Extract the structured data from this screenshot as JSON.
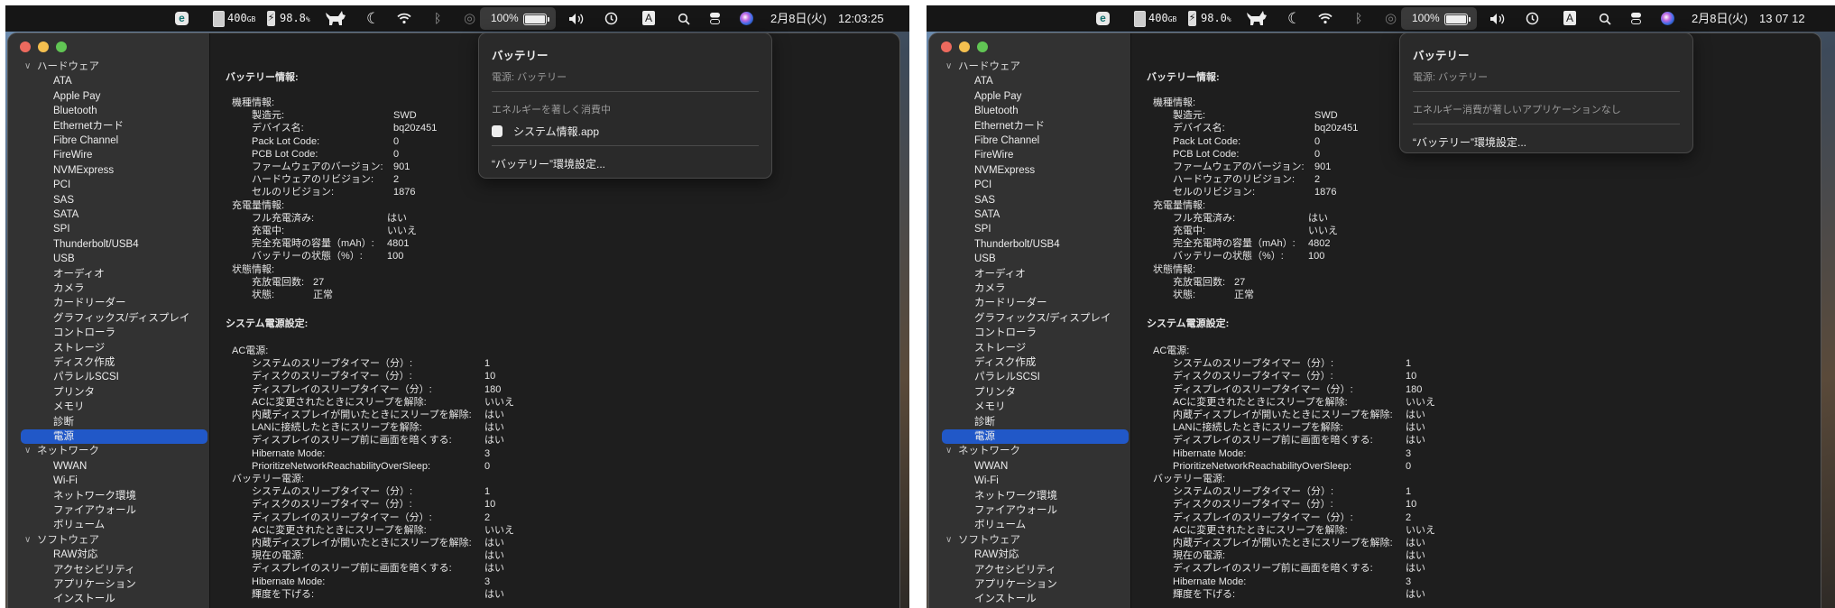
{
  "sidebar": {
    "groups": [
      {
        "label": "ハードウェア",
        "items": [
          "ATA",
          "Apple Pay",
          "Bluetooth",
          "Ethernetカード",
          "Fibre Channel",
          "FireWire",
          "NVMExpress",
          "PCI",
          "SAS",
          "SATA",
          "SPI",
          "Thunderbolt/USB4",
          "USB",
          "オーディオ",
          "カメラ",
          "カードリーダー",
          "グラフィックス/ディスプレイ",
          "コントローラ",
          "ストレージ",
          "ディスク作成",
          "パラレルSCSI",
          "プリンタ",
          "メモリ",
          "診断",
          "電源"
        ]
      },
      {
        "label": "ネットワーク",
        "items": [
          "WWAN",
          "Wi-Fi",
          "ネットワーク環境",
          "ファイアウォール",
          "ボリューム"
        ]
      },
      {
        "label": "ソフトウェア",
        "items": [
          "RAW対応",
          "アクセシビリティ",
          "アプリケーション",
          "インストール"
        ]
      }
    ],
    "selected": "電源",
    "selected_color": "#2158c8"
  },
  "panels": [
    {
      "menubar": {
        "eset": "e",
        "disk_free": "400",
        "disk_unit": "GB",
        "cpu": "98.8",
        "cpu_unit": "%",
        "battery_percent": "100%",
        "ime": "A",
        "date": "2月8日(火)",
        "time": "12:03:25"
      },
      "battery_menu": {
        "title": "バッテリー",
        "power_source": "電源: バッテリー",
        "energy_header": "エネルギーを著しく消費中",
        "apps": [
          "システム情報.app"
        ],
        "preferences": "“バッテリー”環境設定..."
      },
      "content": {
        "battery_title": "バッテリー情報:",
        "model_header": "機種情報:",
        "model": [
          [
            "製造元:",
            "SWD"
          ],
          [
            "デバイス名:",
            "bq20z451"
          ],
          [
            "Pack Lot Code:",
            "0"
          ],
          [
            "PCB Lot Code:",
            "0"
          ],
          [
            "ファームウェアのバージョン:",
            "901"
          ],
          [
            "ハードウェアのリビジョン:",
            "2"
          ],
          [
            "セルのリビジョン:",
            "1876"
          ]
        ],
        "charge_header": "充電量情報:",
        "charge": [
          [
            "フル充電済み:",
            "はい"
          ],
          [
            "充電中:",
            "いいえ"
          ],
          [
            "完全充電時の容量（mAh）:",
            "4801"
          ],
          [
            "バッテリーの状態（%）:",
            "100"
          ]
        ],
        "health_header": "状態情報:",
        "health": [
          [
            "充放電回数:",
            "27"
          ],
          [
            "状態:",
            "正常"
          ]
        ],
        "power_title": "システム電源設定:",
        "ac_header": "AC電源:",
        "ac": [
          [
            "システムのスリープタイマー（分）:",
            "1"
          ],
          [
            "ディスクのスリープタイマー（分）:",
            "10"
          ],
          [
            "ディスプレイのスリープタイマー（分）:",
            "180"
          ],
          [
            "ACに変更されたときにスリープを解除:",
            "いいえ"
          ],
          [
            "内蔵ディスプレイが開いたときにスリープを解除:",
            "はい"
          ],
          [
            "LANに接続したときにスリープを解除:",
            "はい"
          ],
          [
            "ディスプレイのスリープ前に画面を暗くする:",
            "はい"
          ],
          [
            "Hibernate Mode:",
            "3"
          ],
          [
            "PrioritizeNetworkReachabilityOverSleep:",
            "0"
          ]
        ],
        "batt_header": "バッテリー電源:",
        "batt": [
          [
            "システムのスリープタイマー（分）:",
            "1"
          ],
          [
            "ディスクのスリープタイマー（分）:",
            "10"
          ],
          [
            "ディスプレイのスリープタイマー（分）:",
            "2"
          ],
          [
            "ACに変更されたときにスリープを解除:",
            "いいえ"
          ],
          [
            "内蔵ディスプレイが開いたときにスリープを解除:",
            "はい"
          ],
          [
            "現在の電源:",
            "はい"
          ],
          [
            "ディスプレイのスリープ前に画面を暗くする:",
            "はい"
          ],
          [
            "Hibernate Mode:",
            "3"
          ],
          [
            "輝度を下げる:",
            "はい"
          ]
        ]
      }
    },
    {
      "menubar": {
        "eset": "e",
        "disk_free": "400",
        "disk_unit": "GB",
        "cpu": "98.0",
        "cpu_unit": "%",
        "battery_percent": "100%",
        "ime": "A",
        "date": "2月8日(火)",
        "time": "13 07 12"
      },
      "battery_menu": {
        "title": "バッテリー",
        "power_source": "電源: バッテリー",
        "energy_header": "エネルギー消費が著しいアプリケーションなし",
        "apps": [],
        "preferences": "“バッテリー”環境設定..."
      },
      "content": {
        "battery_title": "バッテリー情報:",
        "model_header": "機種情報:",
        "model": [
          [
            "製造元:",
            "SWD"
          ],
          [
            "デバイス名:",
            "bq20z451"
          ],
          [
            "Pack Lot Code:",
            "0"
          ],
          [
            "PCB Lot Code:",
            "0"
          ],
          [
            "ファームウェアのバージョン:",
            "901"
          ],
          [
            "ハードウェアのリビジョン:",
            "2"
          ],
          [
            "セルのリビジョン:",
            "1876"
          ]
        ],
        "charge_header": "充電量情報:",
        "charge": [
          [
            "フル充電済み:",
            "はい"
          ],
          [
            "充電中:",
            "いいえ"
          ],
          [
            "完全充電時の容量（mAh）:",
            "4802"
          ],
          [
            "バッテリーの状態（%）:",
            "100"
          ]
        ],
        "health_header": "状態情報:",
        "health": [
          [
            "充放電回数:",
            "27"
          ],
          [
            "状態:",
            "正常"
          ]
        ],
        "power_title": "システム電源設定:",
        "ac_header": "AC電源:",
        "ac": [
          [
            "システムのスリープタイマー（分）:",
            "1"
          ],
          [
            "ディスクのスリープタイマー（分）:",
            "10"
          ],
          [
            "ディスプレイのスリープタイマー（分）:",
            "180"
          ],
          [
            "ACに変更されたときにスリープを解除:",
            "いいえ"
          ],
          [
            "内蔵ディスプレイが開いたときにスリープを解除:",
            "はい"
          ],
          [
            "LANに接続したときにスリープを解除:",
            "はい"
          ],
          [
            "ディスプレイのスリープ前に画面を暗くする:",
            "はい"
          ],
          [
            "Hibernate Mode:",
            "3"
          ],
          [
            "PrioritizeNetworkReachabilityOverSleep:",
            "0"
          ]
        ],
        "batt_header": "バッテリー電源:",
        "batt": [
          [
            "システムのスリープタイマー（分）:",
            "1"
          ],
          [
            "ディスクのスリープタイマー（分）:",
            "10"
          ],
          [
            "ディスプレイのスリープタイマー（分）:",
            "2"
          ],
          [
            "ACに変更されたときにスリープを解除:",
            "いいえ"
          ],
          [
            "内蔵ディスプレイが開いたときにスリープを解除:",
            "はい"
          ],
          [
            "現在の電源:",
            "はい"
          ],
          [
            "ディスプレイのスリープ前に画面を暗くする:",
            "はい"
          ],
          [
            "Hibernate Mode:",
            "3"
          ],
          [
            "輝度を下げる:",
            "はい"
          ]
        ]
      }
    }
  ]
}
